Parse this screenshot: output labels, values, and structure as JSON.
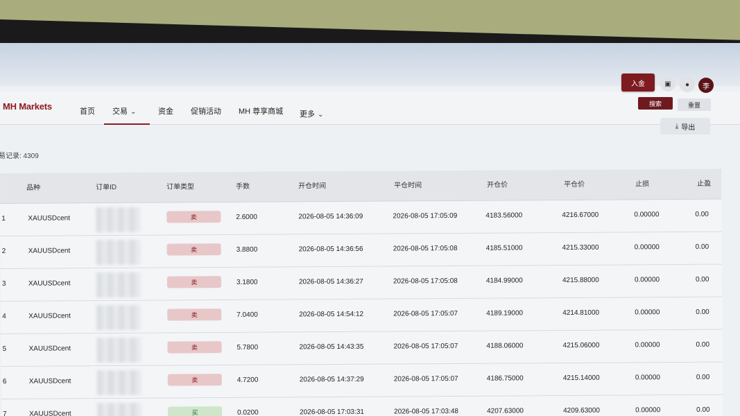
{
  "nav": {
    "logo": "MH Markets",
    "items": [
      "首页",
      "交易",
      "资金",
      "促销活动",
      "MH 尊享商城",
      "更多"
    ],
    "deposit_label": "入金",
    "avatar_text": "李"
  },
  "search": {
    "search_label": "搜索",
    "reset_label": "重置"
  },
  "records": {
    "label": "易记录: 4309",
    "export_label": "导出"
  },
  "table": {
    "headers": [
      "品种",
      "订单ID",
      "订单类型",
      "手数",
      "开仓时间",
      "平仓时间",
      "开仓价",
      "平仓价",
      "止损",
      "止盈"
    ],
    "rows": [
      {
        "idx": "1",
        "symbol": "XAUUSDcent",
        "type": "卖",
        "lots": "2.6000",
        "open_time": "2026-08-05 14:36:09",
        "close_time": "2026-08-05 17:05:09",
        "open_price": "4183.56000",
        "close_price": "4216.67000",
        "sl": "0.00000",
        "tp": "0.00"
      },
      {
        "idx": "2",
        "symbol": "XAUUSDcent",
        "type": "卖",
        "lots": "3.8800",
        "open_time": "2026-08-05 14:36:56",
        "close_time": "2026-08-05 17:05:08",
        "open_price": "4185.51000",
        "close_price": "4215.33000",
        "sl": "0.00000",
        "tp": "0.00"
      },
      {
        "idx": "3",
        "symbol": "XAUUSDcent",
        "type": "卖",
        "lots": "3.1800",
        "open_time": "2026-08-05 14:36:27",
        "close_time": "2026-08-05 17:05:08",
        "open_price": "4184.99000",
        "close_price": "4215.88000",
        "sl": "0.00000",
        "tp": "0.00"
      },
      {
        "idx": "4",
        "symbol": "XAUUSDcent",
        "type": "卖",
        "lots": "7.0400",
        "open_time": "2026-08-05 14:54:12",
        "close_time": "2026-08-05 17:05:07",
        "open_price": "4189.19000",
        "close_price": "4214.81000",
        "sl": "0.00000",
        "tp": "0.00"
      },
      {
        "idx": "5",
        "symbol": "XAUUSDcent",
        "type": "卖",
        "lots": "5.7800",
        "open_time": "2026-08-05 14:43:35",
        "close_time": "2026-08-05 17:05:07",
        "open_price": "4188.06000",
        "close_price": "4215.06000",
        "sl": "0.00000",
        "tp": "0.00"
      },
      {
        "idx": "6",
        "symbol": "XAUUSDcent",
        "type": "卖",
        "lots": "4.7200",
        "open_time": "2026-08-05 14:37:29",
        "close_time": "2026-08-05 17:05:07",
        "open_price": "4186.75000",
        "close_price": "4215.14000",
        "sl": "0.00000",
        "tp": "0.00"
      },
      {
        "idx": "7",
        "symbol": "XAUUSDcent",
        "type": "买",
        "lots": "0.0200",
        "open_time": "2026-08-05 17:03:31",
        "close_time": "2026-08-05 17:03:48",
        "open_price": "4207.63000",
        "close_price": "4209.63000",
        "sl": "0.00000",
        "tp": "0.00"
      }
    ]
  },
  "colors": {
    "brand": "#8c1c22",
    "sell_badge": "#e8c7c9",
    "buy_badge": "#cfe6cb"
  }
}
